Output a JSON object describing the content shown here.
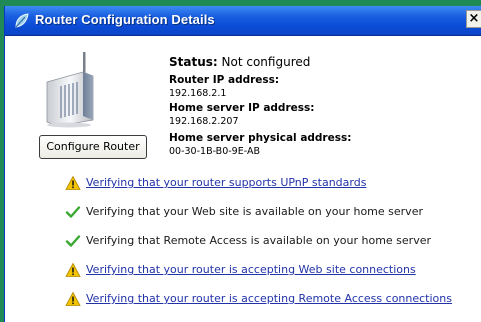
{
  "window": {
    "title": "Router Configuration Details",
    "close_label": "×"
  },
  "router": {
    "configure_button": "Configure Router",
    "status_label": "Status:",
    "status_value": "Not configured",
    "ip_label": "Router IP address:",
    "ip_value": "192.168.2.1",
    "server_ip_label": "Home server IP address:",
    "server_ip_value": "192.168.2.207",
    "mac_label": "Home server physical address:",
    "mac_value": "00-30-1B-B0-9E-AB"
  },
  "checks": [
    {
      "icon": "warning-icon",
      "text": "Verifying that your router supports UPnP standards"
    },
    {
      "icon": "checkmark-icon",
      "text": "Verifying that your Web site is available on your home server"
    },
    {
      "icon": "checkmark-icon",
      "text": "Verifying that Remote Access is available on your home server"
    },
    {
      "icon": "warning-icon",
      "text": "Verifying that your router is accepting Web site connections"
    },
    {
      "icon": "warning-icon",
      "text": "Verifying that your router is accepting Remote Access connections"
    }
  ],
  "colors": {
    "titlebar": "#0b4bd6",
    "link": "#2233aa",
    "warning": "#f2c400",
    "check": "#3aa832",
    "frame": "#1f8a55"
  }
}
